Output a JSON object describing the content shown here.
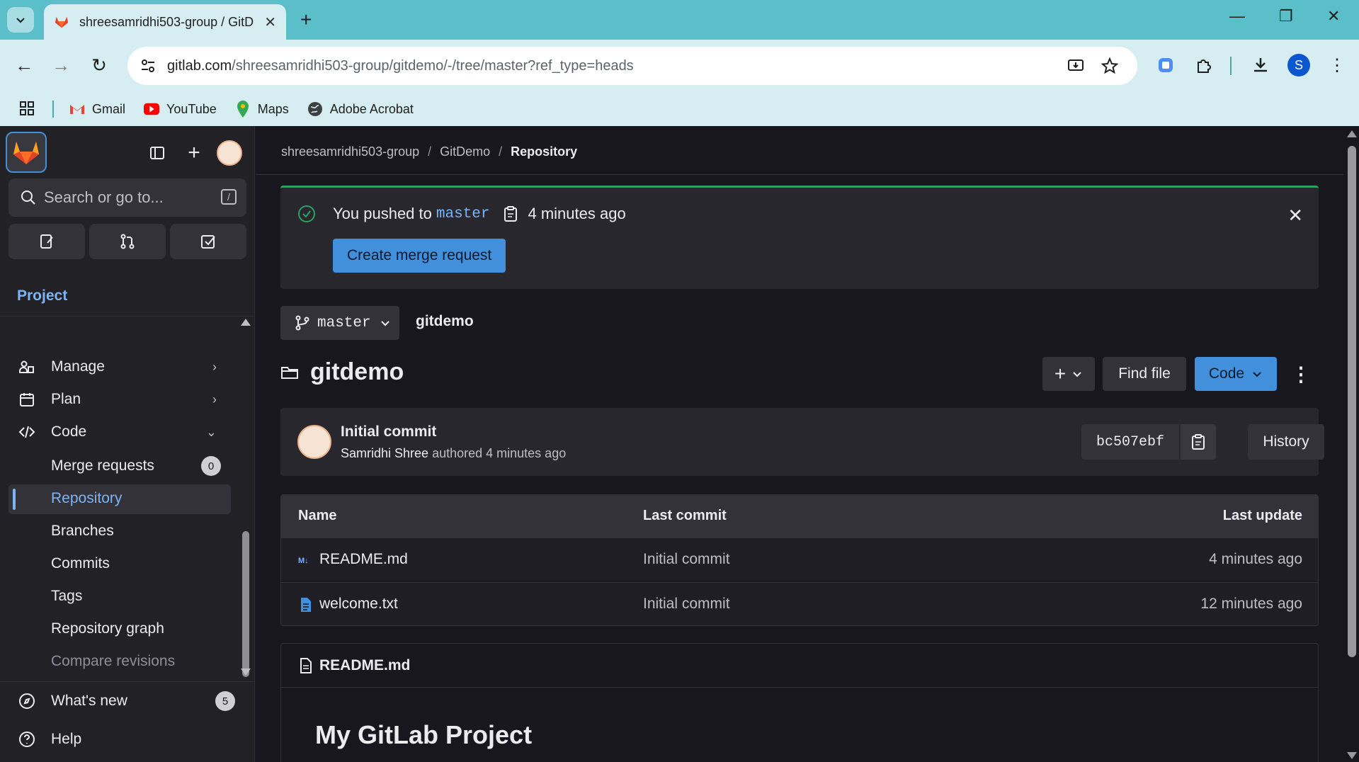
{
  "browser": {
    "tab_title": "shreesamridhi503-group / GitD",
    "url_host": "gitlab.com",
    "url_path": "/shreesamridhi503-group/gitdemo/-/tree/master?ref_type=heads",
    "profile_initial": "S",
    "bookmarks": [
      "Gmail",
      "YouTube",
      "Maps",
      "Adobe Acrobat"
    ]
  },
  "sidebar": {
    "search_placeholder": "Search or go to...",
    "search_shortcut": "/",
    "section": "Project",
    "items": [
      {
        "label": "Manage",
        "icon": "users-icon"
      },
      {
        "label": "Plan",
        "icon": "calendar-icon"
      },
      {
        "label": "Code",
        "icon": "code-icon"
      }
    ],
    "code_sub": [
      "Merge requests",
      "Repository",
      "Branches",
      "Commits",
      "Tags",
      "Repository graph",
      "Compare revisions"
    ],
    "merge_requests_count": "0",
    "whats_new": "What's new",
    "whats_new_count": "5",
    "help": "Help"
  },
  "breadcrumb": [
    "shreesamridhi503-group",
    "GitDemo",
    "Repository"
  ],
  "alert": {
    "prefix": "You pushed to",
    "branch": "master",
    "when": "4 minutes ago",
    "button": "Create merge request"
  },
  "branch_selector": "master",
  "repo_path": "gitdemo",
  "project_title": "gitdemo",
  "actions": {
    "find_file": "Find file",
    "code": "Code",
    "add": "+"
  },
  "last_commit": {
    "title": "Initial commit",
    "author": "Samridhi Shree",
    "meta": "authored 4 minutes ago",
    "sha": "bc507ebf",
    "history": "History"
  },
  "files": {
    "headers": [
      "Name",
      "Last commit",
      "Last update"
    ],
    "rows": [
      {
        "name": "README.md",
        "commit": "Initial commit",
        "updated": "4 minutes ago",
        "icon": "markdown-icon"
      },
      {
        "name": "welcome.txt",
        "commit": "Initial commit",
        "updated": "12 minutes ago",
        "icon": "document-icon"
      }
    ]
  },
  "readme": {
    "filename": "README.md",
    "heading": "My GitLab Project"
  },
  "colors": {
    "accent": "#428fdc",
    "link": "#7cb4f5",
    "success": "#2da160",
    "bg": "#18171d"
  }
}
